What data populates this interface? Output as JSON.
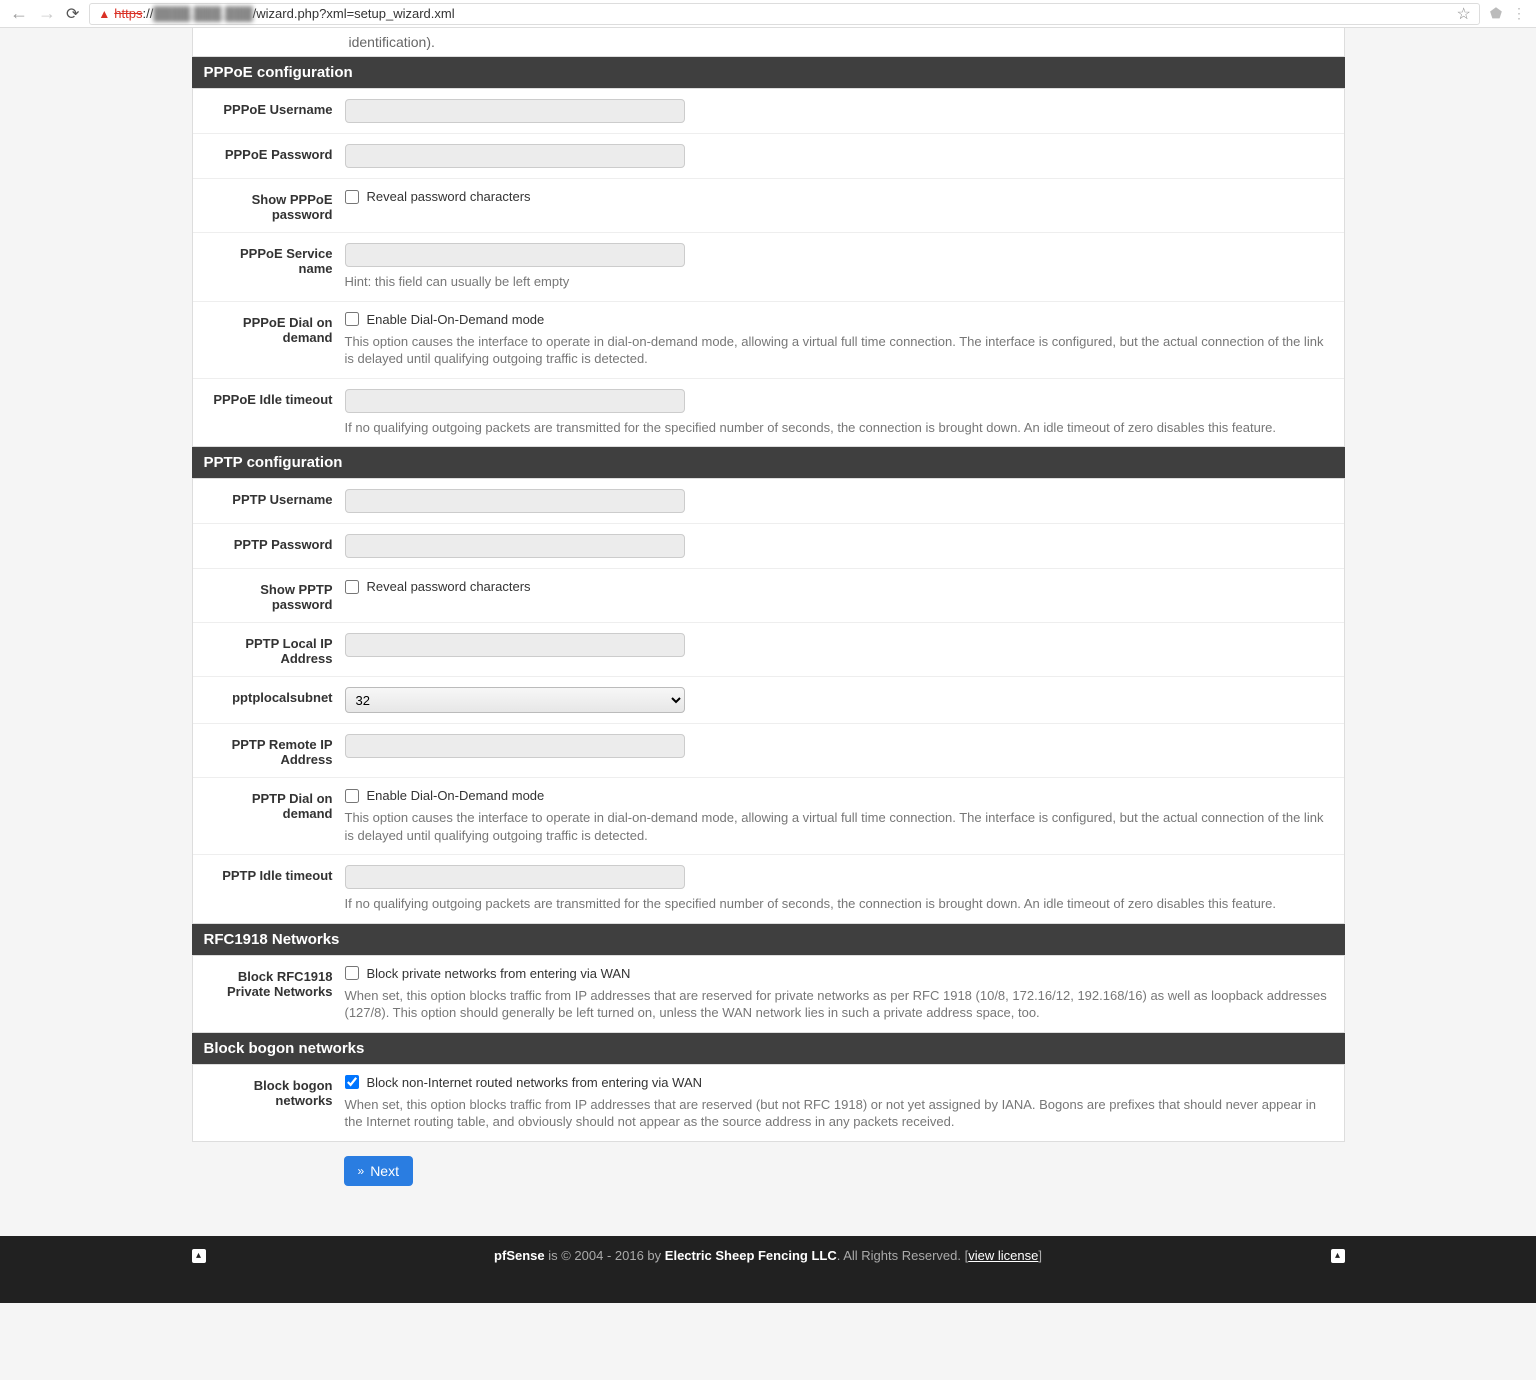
{
  "url": {
    "scheme": "https",
    "host_blurred": "████.███.███",
    "path": "/wizard.php?xml=setup_wizard.xml"
  },
  "partial_header_text": "identification).",
  "sections": {
    "pppoe": {
      "title": "PPPoE configuration",
      "username_label": "PPPoE Username",
      "password_label": "PPPoE Password",
      "show_pw_label": "Show PPPoE password",
      "show_pw_check": "Reveal password characters",
      "service_label": "PPPoE Service name",
      "service_hint": "Hint: this field can usually be left empty",
      "dial_label": "PPPoE Dial on demand",
      "dial_check": "Enable Dial-On-Demand mode",
      "dial_help": "This option causes the interface to operate in dial-on-demand mode, allowing a virtual full time connection. The interface is configured, but the actual connection of the link is delayed until qualifying outgoing traffic is detected.",
      "idle_label": "PPPoE Idle timeout",
      "idle_help": "If no qualifying outgoing packets are transmitted for the specified number of seconds, the connection is brought down. An idle timeout of zero disables this feature."
    },
    "pptp": {
      "title": "PPTP configuration",
      "username_label": "PPTP Username",
      "password_label": "PPTP Password",
      "show_pw_label": "Show PPTP password",
      "show_pw_check": "Reveal password characters",
      "localip_label": "PPTP Local IP Address",
      "subnet_label": "pptplocalsubnet",
      "subnet_value": "32",
      "remoteip_label": "PPTP Remote IP Address",
      "dial_label": "PPTP Dial on demand",
      "dial_check": "Enable Dial-On-Demand mode",
      "dial_help": "This option causes the interface to operate in dial-on-demand mode, allowing a virtual full time connection. The interface is configured, but the actual connection of the link is delayed until qualifying outgoing traffic is detected.",
      "idle_label": "PPTP Idle timeout",
      "idle_help": "If no qualifying outgoing packets are transmitted for the specified number of seconds, the connection is brought down. An idle timeout of zero disables this feature."
    },
    "rfc1918": {
      "title": "RFC1918 Networks",
      "label": "Block RFC1918 Private Networks",
      "check": "Block private networks from entering via WAN",
      "help": "When set, this option blocks traffic from IP addresses that are reserved for private networks as per RFC 1918 (10/8, 172.16/12, 192.168/16) as well as loopback addresses (127/8). This option should generally be left turned on, unless the WAN network lies in such a private address space, too."
    },
    "bogon": {
      "title": "Block bogon networks",
      "label": "Block bogon networks",
      "check": "Block non-Internet routed networks from entering via WAN",
      "help": "When set, this option blocks traffic from IP addresses that are reserved (but not RFC 1918) or not yet assigned by IANA. Bogons are prefixes that should never appear in the Internet routing table, and obviously should not appear as the source address in any packets received."
    }
  },
  "next_button": "Next",
  "footer": {
    "brand": "pfSense",
    "mid": " is © 2004 - 2016 by ",
    "company": "Electric Sheep Fencing LLC",
    "rights": ". All Rights Reserved. [",
    "license": "view license",
    "close": "]"
  }
}
